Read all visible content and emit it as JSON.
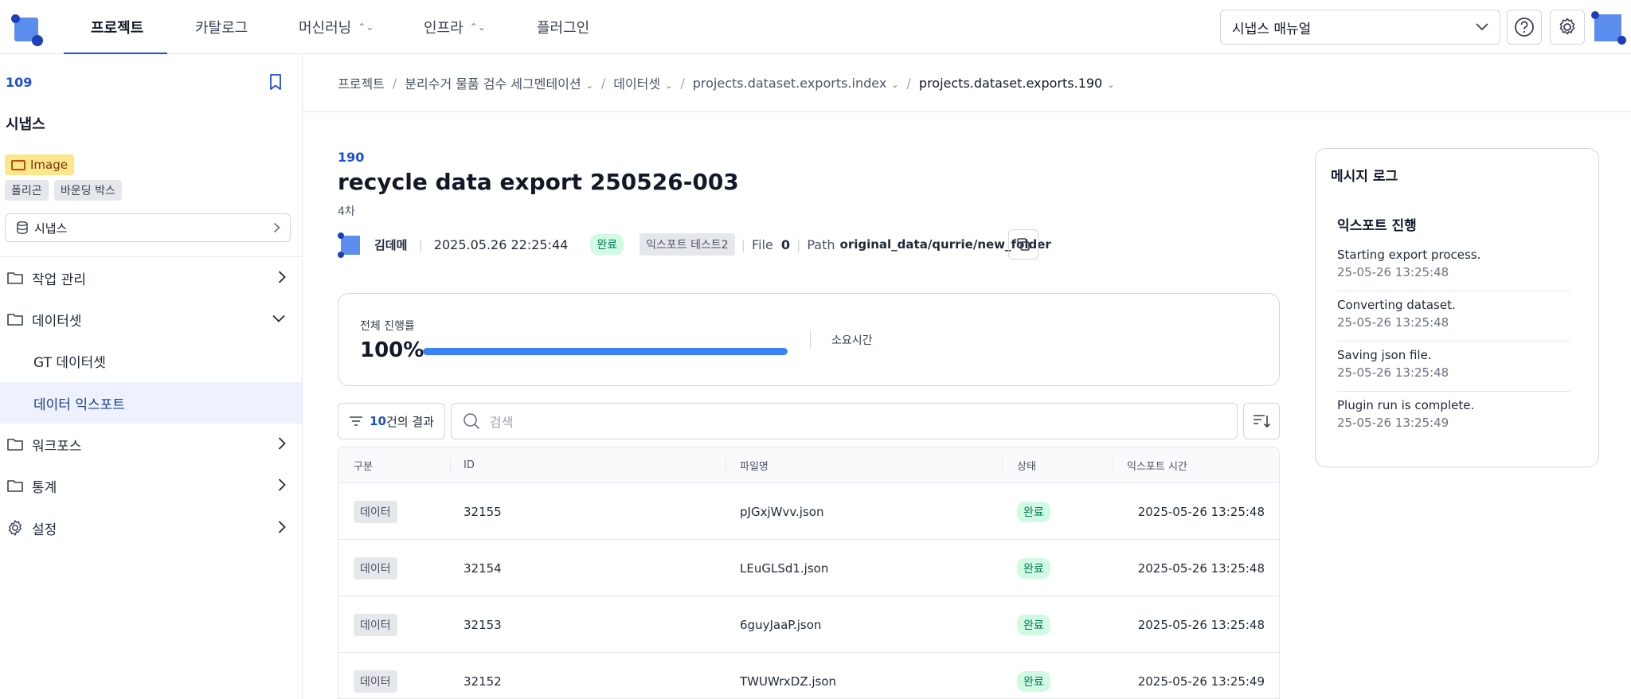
{
  "nav": {
    "items": [
      {
        "label": "프로젝트"
      },
      {
        "label": "카탈로그"
      },
      {
        "label": "머신러닝"
      },
      {
        "label": "인프라"
      },
      {
        "label": "플러그인"
      }
    ],
    "manual_select": "시냅스 매뉴얼"
  },
  "sidebar": {
    "project_id": "109",
    "project_name": "시냅스",
    "tag_image": "Image",
    "tags": [
      "폴리곤",
      "바운딩 박스"
    ],
    "project_select": "시냅스",
    "items": [
      {
        "label": "작업 관리"
      },
      {
        "label": "데이터셋"
      },
      {
        "label": "GT 데이터셋"
      },
      {
        "label": "데이터 익스포트"
      },
      {
        "label": "워크포스"
      },
      {
        "label": "통계"
      },
      {
        "label": "설정"
      }
    ]
  },
  "breadcrumb": {
    "items": [
      {
        "label": "프로젝트"
      },
      {
        "label": "분리수거 물품 검수 세그멘테이션"
      },
      {
        "label": "데이터셋"
      },
      {
        "label": "projects.dataset.exports.index"
      },
      {
        "label": "projects.dataset.exports.190"
      }
    ],
    "sep": "/"
  },
  "export": {
    "id": "190",
    "title": "recycle data export 250526-003",
    "round": "4차",
    "author": "김데메",
    "datetime": "2025.05.26 22:25:44",
    "status": "완료",
    "plugin_tag": "익스포트 테스트2",
    "file_label": "File",
    "file_count": "0",
    "path_label": "Path",
    "path_value": "original_data/qurrie/new_folder"
  },
  "progress": {
    "label": "전체 진행률",
    "value_text": "100%",
    "fraction": 1.0,
    "time_label": "소요시간"
  },
  "filter": {
    "count": "10",
    "suffix": "건의 결과",
    "search_placeholder": "검색"
  },
  "table": {
    "headers": [
      "구분",
      "ID",
      "파일명",
      "상태",
      "익스포트 시간"
    ],
    "rows": [
      {
        "type": "데이터",
        "id": "32155",
        "filename": "pJGxjWvv.json",
        "status": "완료",
        "time": "2025-05-26 13:25:48"
      },
      {
        "type": "데이터",
        "id": "32154",
        "filename": "LEuGLSd1.json",
        "status": "완료",
        "time": "2025-05-26 13:25:48"
      },
      {
        "type": "데이터",
        "id": "32153",
        "filename": "6guyJaaP.json",
        "status": "완료",
        "time": "2025-05-26 13:25:48"
      },
      {
        "type": "데이터",
        "id": "32152",
        "filename": "TWUWrxDZ.json",
        "status": "완료",
        "time": "2025-05-26 13:25:49"
      }
    ]
  },
  "log": {
    "title": "메시지 로그",
    "section": "익스포트 진행",
    "entries": [
      {
        "message": "Starting export process.",
        "time": "25-05-26 13:25:48"
      },
      {
        "message": "Converting dataset.",
        "time": "25-05-26 13:25:48"
      },
      {
        "message": "Saving json file.",
        "time": "25-05-26 13:25:48"
      },
      {
        "message": "Plugin run is complete.",
        "time": "25-05-26 13:25:49"
      }
    ]
  },
  "colors": {
    "accent": "#1d4ed8",
    "progress": "#3b82f6",
    "success_bg": "#d1fae5",
    "success_text": "#047857",
    "image_tag": "#fde68a"
  }
}
